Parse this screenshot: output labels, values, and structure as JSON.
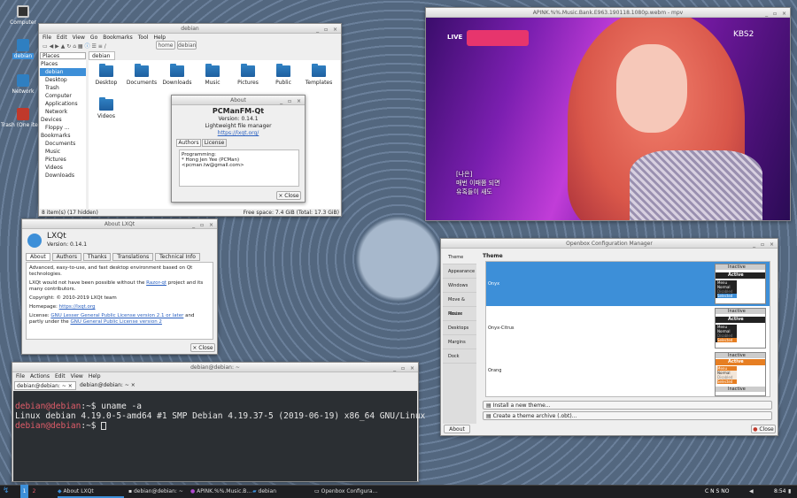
{
  "desktop": {
    "icons": [
      "Computer",
      "debian",
      "Network",
      "Trash (One item)"
    ]
  },
  "fm": {
    "title": "debian",
    "menu": [
      "File",
      "Edit",
      "View",
      "Go",
      "Bookmarks",
      "Tool",
      "Help"
    ],
    "path": [
      "home",
      "debian"
    ],
    "tab": "debian",
    "places_combo": "Places",
    "places_header": "Places",
    "places": [
      "debian",
      "Desktop",
      "Trash",
      "Computer",
      "Applications",
      "Network"
    ],
    "devices_header": "Devices",
    "devices": [
      "Floppy ..."
    ],
    "bookmarks_header": "Bookmarks",
    "bookmarks": [
      "Documents",
      "Music",
      "Pictures",
      "Videos",
      "Downloads"
    ],
    "files": [
      "Desktop",
      "Documents",
      "Downloads",
      "Music",
      "Pictures",
      "Public",
      "Templates",
      "Videos"
    ],
    "status_left": "8 item(s) (17 hidden)",
    "status_right": "Free space: 7.4 GiB (Total: 17.3 GiB)"
  },
  "about_fm": {
    "title": "About",
    "name": "PCManFM-Qt",
    "version": "Version: 0.14.1",
    "desc": "Lightweight file manager",
    "url": "https://lxqt.org/",
    "tabs": [
      "Authors",
      "License"
    ],
    "text1": "Programming:",
    "text2": "* Hong Jen Yee (PCMan)",
    "text3": "<pcman.tw@gmail.com>",
    "close": "Close"
  },
  "mpv": {
    "title": "APINK.%%.Music.Bank.E963.190118.1080p.webm - mpv",
    "live": "LIVE",
    "kbs": "KBS2",
    "sub1": "[나은]",
    "sub2": "매번 이때쯤 되면",
    "sub3": "유혹들이 새도"
  },
  "about_lxqt": {
    "title": "About LXQt",
    "name": "LXQt",
    "version": "Version: 0.14.1",
    "tabs": [
      "About",
      "Authors",
      "Thanks",
      "Translations",
      "Technical Info"
    ],
    "p1": "Advanced, easy-to-use, and fast desktop environment based on Qt technologies.",
    "p2a": "LXQt would not have been possible without the ",
    "p2link": "Razor-qt",
    "p2b": " project and its many contributors.",
    "p3": "Copyright: © 2010-2019 LXQt team",
    "p4a": "Homepage: ",
    "p4link": "https://lxqt.org",
    "p5a": "License: ",
    "p5link1": "GNU Lesser General Public License version 2.1 or later",
    "p5b": " and partly under the ",
    "p5link2": "GNU General Public License version 2",
    "close": "Close"
  },
  "openbox": {
    "title": "Openbox Configuration Manager",
    "nav": [
      "Theme",
      "Appearance",
      "Windows",
      "Move & Resize",
      "Mouse",
      "Desktops",
      "Margins",
      "Dock"
    ],
    "heading": "Theme",
    "themes": [
      "Onyx",
      "Onyx-Citrus",
      "Orang"
    ],
    "inactive": "Inactive",
    "active": "Active",
    "menu": [
      "Menu",
      "Normal",
      "Disabled",
      "Selected"
    ],
    "install": "Install a new theme...",
    "create": "Create a theme archive (.obt)...",
    "about": "About",
    "close": "Close"
  },
  "term": {
    "title": "debian@debian: ~",
    "menu": [
      "File",
      "Actions",
      "Edit",
      "View",
      "Help"
    ],
    "tabs": [
      "debian@debian: ~",
      "debian@debian: ~"
    ],
    "prompt1": "debian@debian",
    "cmd1": ":~$ uname -a",
    "out": "Linux debian 4.19.0-5-amd64 #1 SMP Debian 4.19.37-5 (2019-06-19) x86_64 GNU/Linux",
    "prompt2": "debian@debian",
    "cmd2": ":~$ "
  },
  "taskbar": {
    "ws1": "1",
    "ws2": "2",
    "items": [
      "About LXQt",
      "debian@debian: ~",
      "APINK.%%.Music.B...",
      "debian",
      "Openbox Configura..."
    ],
    "tray": "C N S NO",
    "time": "8:54"
  },
  "colors": {
    "accent": "#3d8fd8",
    "terminal_bg": "#2b2f33",
    "prompt": "#e35d6a"
  }
}
